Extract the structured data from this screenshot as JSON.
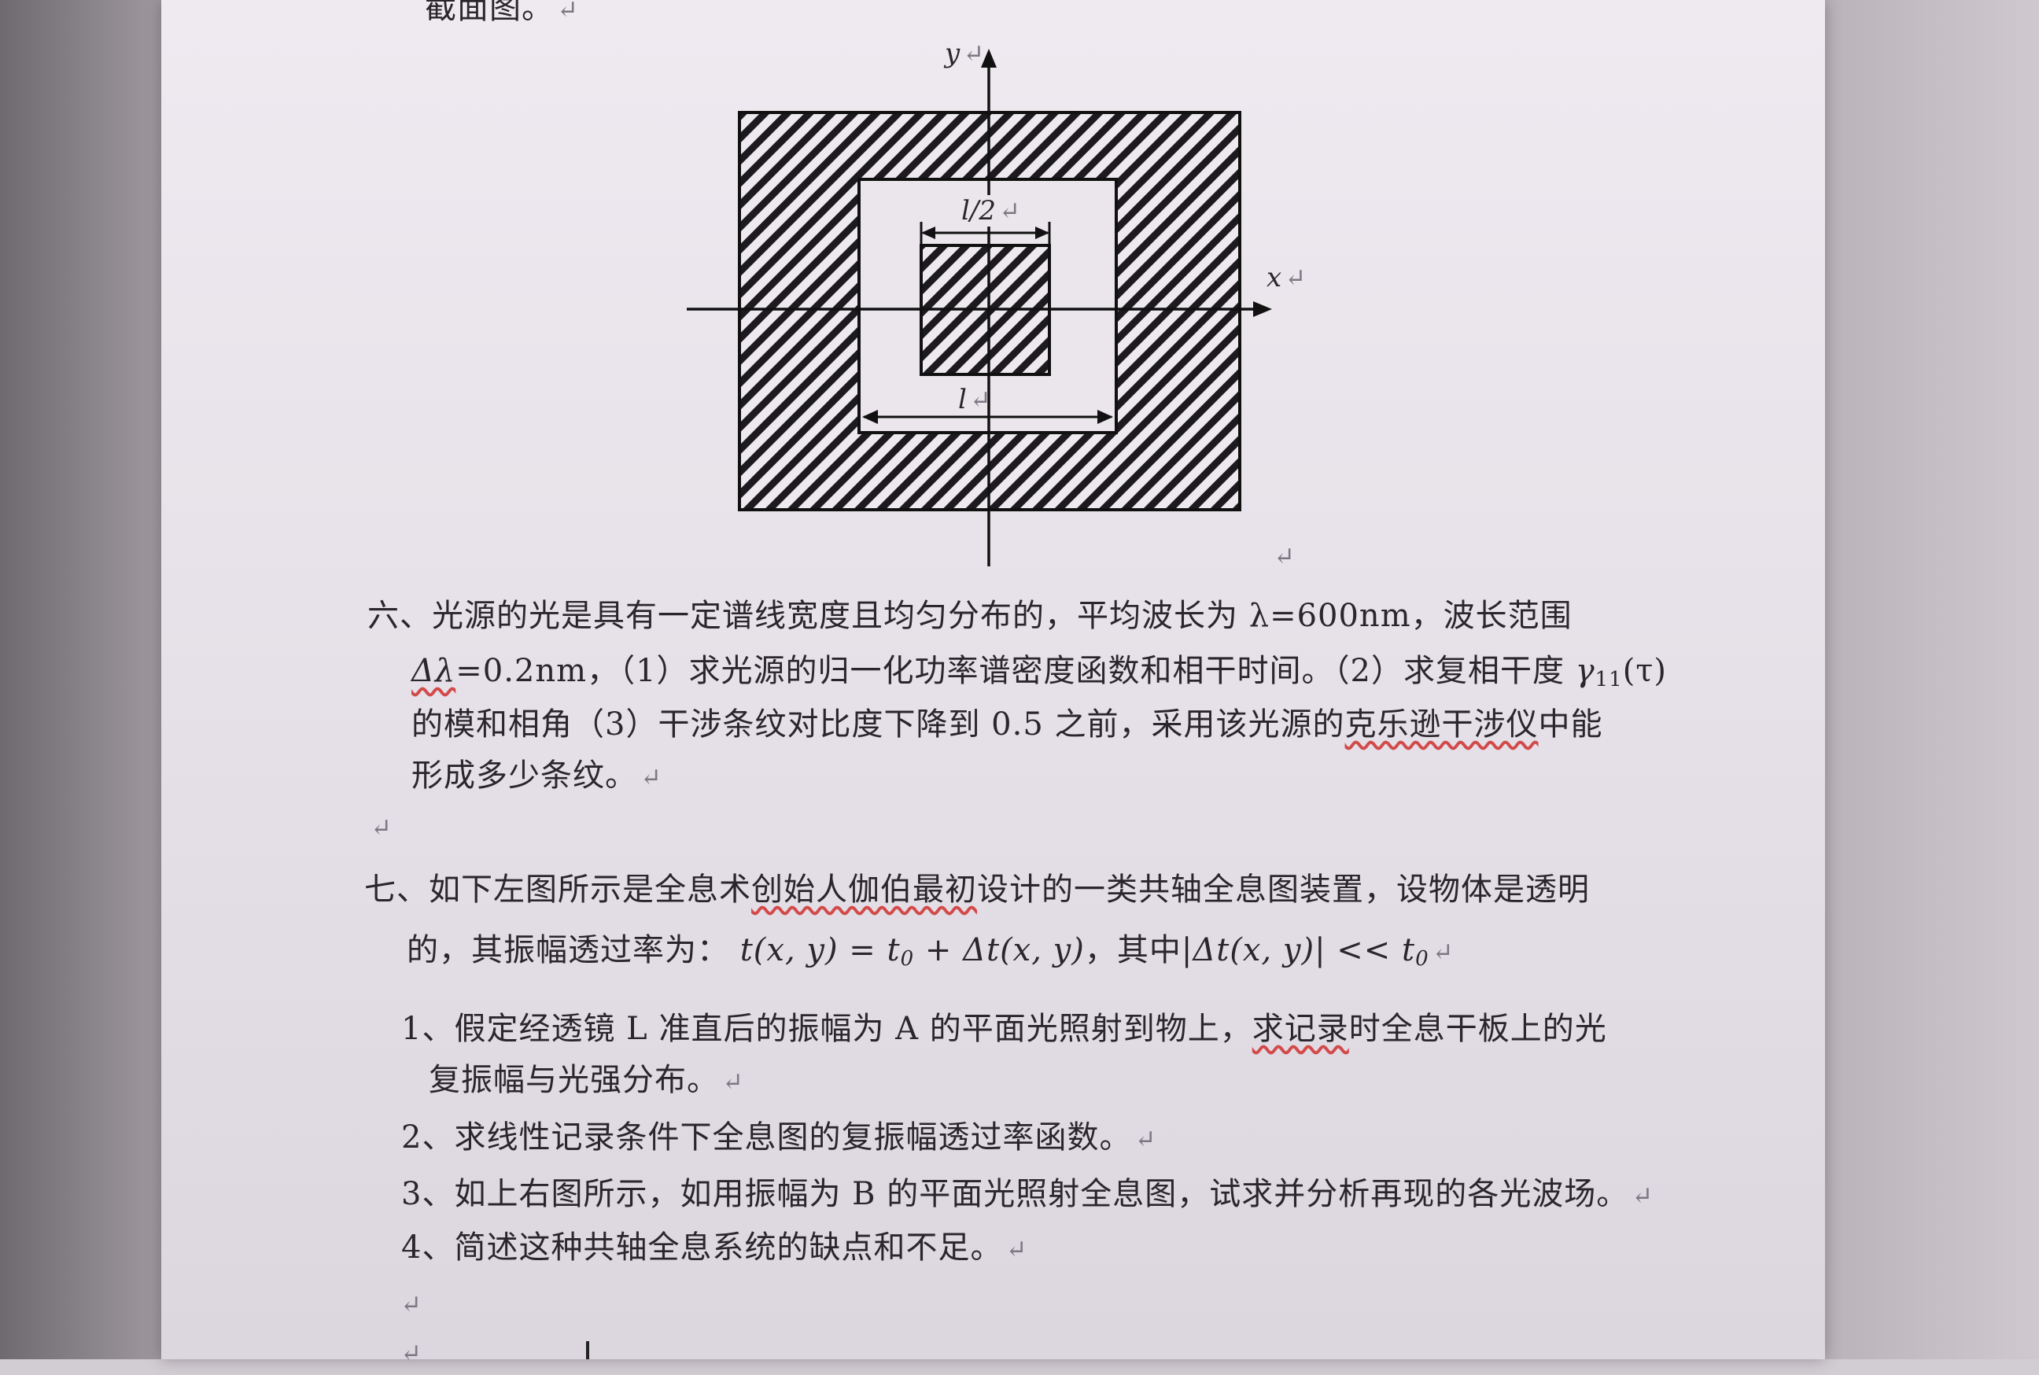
{
  "doc": {
    "top_fragment": "截面图。",
    "figure": {
      "y_axis_label": "y",
      "x_axis_label": "x",
      "inner_width_label": "l/2",
      "middle_width_label": "l"
    },
    "q6": {
      "line1": "六、光源的光是具有一定谱线宽度且均匀分布的，平均波长为 λ=600nm，波长范围",
      "line2_a": "Δλ",
      "line2_b": "=0.2nm，（1）求光源的归一化功率谱密度函数和相干时间。（2）求复相干度 ",
      "line2_gamma": "γ",
      "line2_sub": "11",
      "line2_tau": "(τ)",
      "line3_a": "的模和相角（3）干涉条纹对比度下降到 0.5 之前，采用该光源的",
      "line3_underlined": "克乐逊干涉仪",
      "line3_b": "中能",
      "line4": "形成多少条纹。"
    },
    "q7": {
      "line1_a": "七、如下左图所示是全息术",
      "line1_underlined": "创始人伽伯最初",
      "line1_b": "设计的一类共轴全息图装置，设物体是透明",
      "line2_a": "的，其振幅透过率为：",
      "eq1": "t(x, y) = t",
      "eq1_sub": "0",
      "eq1_b": " + Δt(x, y)",
      "line2_b": "，其中",
      "eq2": "|Δt(x, y)| << t",
      "eq2_sub": "0",
      "item1_a": "1、假定经透镜 L 准直后的振幅为 A 的平面光照射到物上，",
      "item1_underlined": "求记录",
      "item1_b": "时全息干板上的光",
      "item1_line2": "复振幅与光强分布。",
      "item2": "2、求线性记录条件下全息图的复振幅透过率函数。",
      "item3": "3、如上右图所示，如用振幅为 B 的平面光照射全息图，试求并分析再现的各光波场。",
      "item4": "4、简述这种共轴全息系统的缺点和不足。"
    },
    "para_mark": "↵"
  }
}
